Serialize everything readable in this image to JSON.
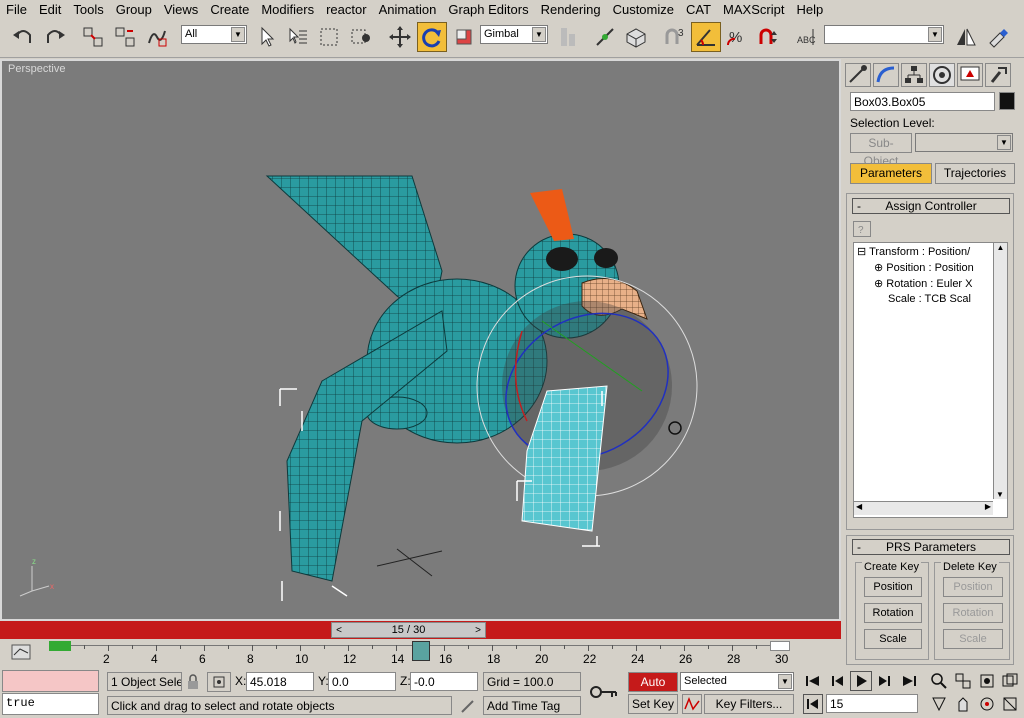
{
  "menu": [
    "File",
    "Edit",
    "Tools",
    "Group",
    "Views",
    "Create",
    "Modifiers",
    "reactor",
    "Animation",
    "Graph Editors",
    "Rendering",
    "Customize",
    "CAT",
    "MAXScript",
    "Help"
  ],
  "toolbar": {
    "selection_filter": "All",
    "coord_system": "Gimbal",
    "named_selection": "",
    "icons": [
      "undo-icon",
      "redo-icon",
      "link-icon",
      "unlink-icon",
      "bind-space-warp-icon",
      "select-object-icon",
      "select-by-name-icon",
      "rectangular-selection-icon",
      "window-crossing-icon",
      "select-move-icon",
      "select-rotate-icon",
      "select-scale-icon",
      "pivot-center-icon",
      "select-manipulate-icon",
      "keyboard-shortcut-icon",
      "snap-toggle-icon",
      "angle-snap-icon",
      "percent-snap-icon",
      "spinner-snap-icon",
      "edit-named-selections-icon",
      "mirror-icon",
      "align-icon"
    ],
    "spinner_snap_value": "3"
  },
  "viewport": {
    "label": "Perspective",
    "axis": {
      "x": "x",
      "y": "y",
      "z": "z"
    }
  },
  "timeslider": {
    "label": "15 / 30",
    "current": 15,
    "max": 30
  },
  "trackbar": {
    "ticks": [
      "2",
      "4",
      "6",
      "8",
      "10",
      "12",
      "14",
      "16",
      "18",
      "20",
      "22",
      "24",
      "26",
      "28",
      "30"
    ]
  },
  "status": {
    "script_listener": "true",
    "selection_count": "1 Object Sele",
    "x_value": "45.018",
    "y_value": "0.0",
    "z_value": "-0.0",
    "grid": "Grid = 100.0",
    "x_label": "X:",
    "y_label": "Y:",
    "z_label": "Z:",
    "prompt": "Click and drag to select and rotate objects",
    "add_time_tag": "Add Time Tag",
    "auto_key": "Auto Key",
    "set_key": "Set Key",
    "key_mode": "Selected",
    "key_filters": "Key Filters...",
    "frame": "15"
  },
  "cmdpanel": {
    "object_name": "Box03.Box05",
    "selection_level_label": "Selection Level:",
    "sub_object": "Sub-Object",
    "tabs": [
      "Parameters",
      "Trajectories"
    ],
    "assign_controller": "Assign Controller",
    "controllers": [
      "Transform : Position/",
      "Position : Position",
      "Rotation : Euler X",
      "Scale : TCB Scal"
    ],
    "prs_parameters": "PRS Parameters",
    "create_key": "Create Key",
    "delete_key": "Delete Key",
    "create_buttons": [
      "Position",
      "Rotation",
      "Scale"
    ],
    "delete_buttons": [
      "Position",
      "Rotation",
      "Scale"
    ]
  },
  "colors": {
    "accent": "#f2be3a",
    "auto_key_red": "#c51a1a",
    "bird_teal": "#2a9ba0",
    "viewport_bg": "#7b7b7b"
  }
}
